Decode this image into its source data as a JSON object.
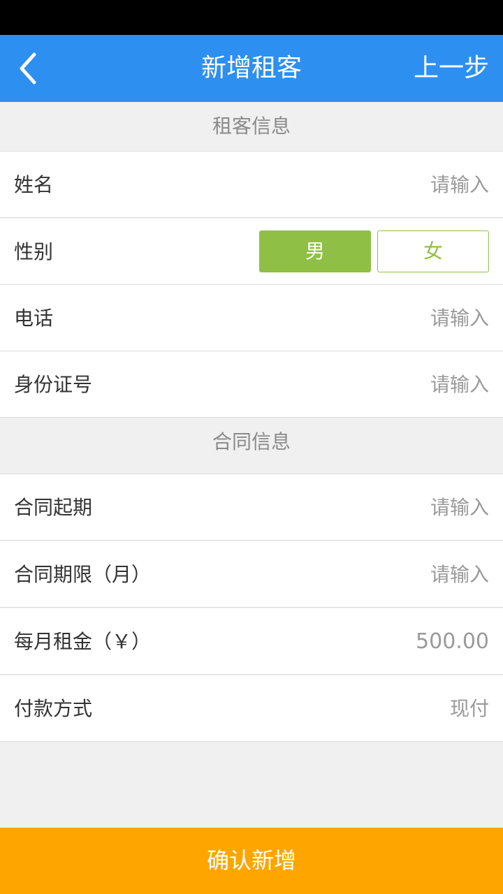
{
  "header": {
    "title": "新增租客",
    "prev_label": "上一步"
  },
  "tenant_section": {
    "title": "租客信息",
    "name": {
      "label": "姓名",
      "placeholder": "请输入"
    },
    "gender": {
      "label": "性别",
      "male": "男",
      "female": "女",
      "selected": "男"
    },
    "phone": {
      "label": "电话",
      "placeholder": "请输入"
    },
    "id_number": {
      "label": "身份证号",
      "placeholder": "请输入"
    }
  },
  "contract_section": {
    "title": "合同信息",
    "start_date": {
      "label": "合同起期",
      "placeholder": "请输入"
    },
    "term": {
      "label": "合同期限（月）",
      "placeholder": "请输入"
    },
    "monthly_rent": {
      "label": "每月租金（￥）",
      "value": "500.00"
    },
    "payment_method": {
      "label": "付款方式",
      "value": "现付"
    }
  },
  "footer": {
    "confirm_label": "确认新增"
  },
  "colors": {
    "primary_blue": "#2d8ff0",
    "accent_green": "#8fbf45",
    "confirm_orange": "#ffa500"
  }
}
